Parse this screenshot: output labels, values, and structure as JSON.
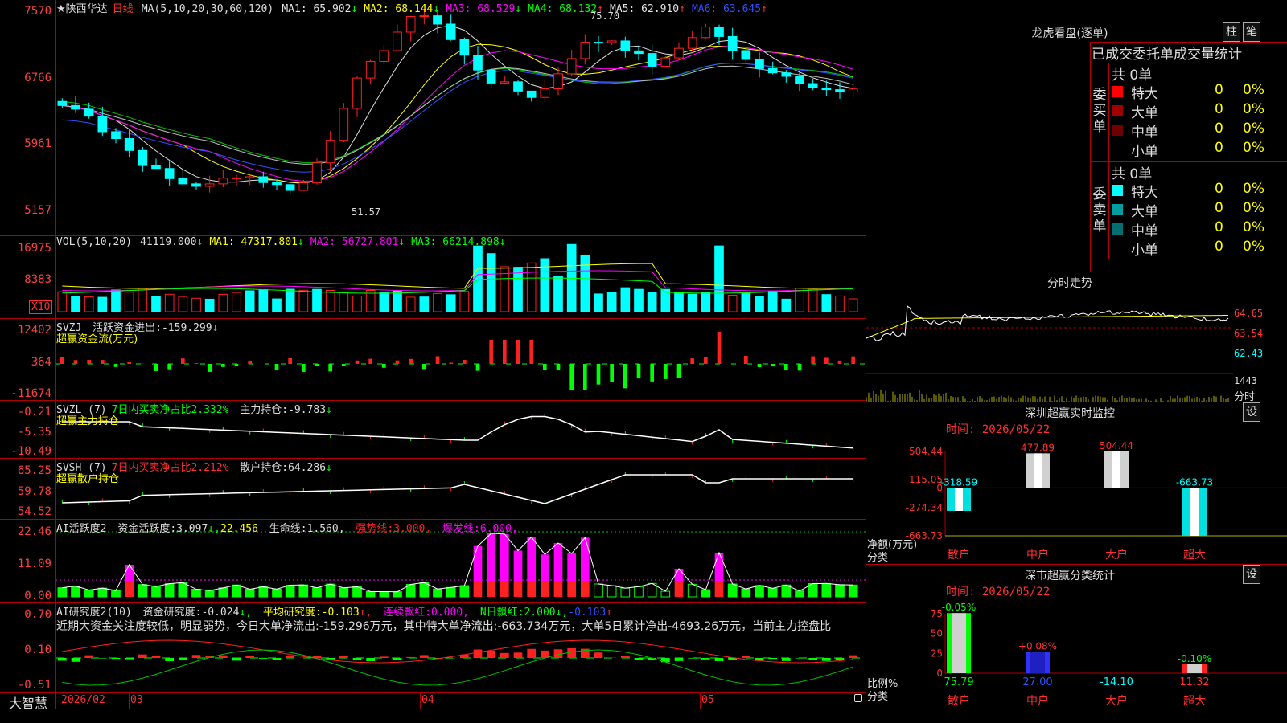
{
  "main_legend": {
    "star": "★",
    "stock_name": "陕西华达",
    "period": "日线",
    "ma_params": "MA(5,10,20,30,60,120)",
    "items": [
      {
        "label": "MA1:",
        "value": "65.902",
        "arrow": "↓",
        "color": "#e0e0e0"
      },
      {
        "label": "MA2:",
        "value": "68.144",
        "arrow": "↓",
        "color": "#ffff00"
      },
      {
        "label": "MA3:",
        "value": "68.529",
        "arrow": "↓",
        "color": "#ff00ff"
      },
      {
        "label": "MA4:",
        "value": "68.132",
        "arrow": "↑",
        "color": "#00ff00"
      },
      {
        "label": "MA5:",
        "value": "62.910",
        "arrow": "↑",
        "color": "#e0e0e0"
      },
      {
        "label": "MA6:",
        "value": "63.645",
        "arrow": "↑",
        "color": "#3050ff"
      }
    ],
    "high_mark": "75.70",
    "low_mark": "51.57"
  },
  "main_axis": [
    "7570",
    "6766",
    "5961",
    "5157"
  ],
  "vol_legend": {
    "title": "VOL(5,10,20)",
    "items": [
      {
        "label": "",
        "value": "41119.000",
        "arrow": "↓",
        "color": "#e0e0e0"
      },
      {
        "label": "MA1:",
        "value": "47317.801",
        "arrow": "↓",
        "color": "#ffff00"
      },
      {
        "label": "MA2:",
        "value": "56727.801",
        "arrow": "↓",
        "color": "#ff00ff"
      },
      {
        "label": "MA3:",
        "value": "66214.898",
        "arrow": "↓",
        "color": "#00ff00"
      }
    ]
  },
  "vol_axis": [
    "16975",
    "8383"
  ],
  "vol_unit": "X10",
  "svzj": {
    "title": "SVZJ",
    "label": "活跃资金进出:",
    "value": "-159.299",
    "arrow": "↓",
    "sub": "超赢资金流(万元)",
    "axis": [
      "12402",
      "364",
      "-11674"
    ]
  },
  "svzl": {
    "title": "SVZL (7)",
    "label": "7日内买卖净占比2.332%",
    "label2": "主力持仓:",
    "value": "-9.783",
    "arrow": "↓",
    "sub": "超赢主力持仓",
    "axis": [
      "-0.21",
      "-5.35",
      "-10.49"
    ]
  },
  "svsh": {
    "title": "SVSH (7)",
    "label": "7日内买卖净占比2.212%",
    "label2": "散户持仓:",
    "value": "64.286",
    "arrow": "↓",
    "sub": "超赢散户持仓",
    "axis": [
      "65.25",
      "59.78",
      "54.52"
    ]
  },
  "ai_active": {
    "title": "AI活跃度2",
    "l1": "资金活跃度:",
    "v1": "3.097",
    "a1": "↓",
    "v2": "22.456",
    "a2": ",",
    "l3": "生命线:",
    "v3": "1.560,",
    "l4": "强势线:",
    "v4": "3.000,",
    "l5": "爆发线:",
    "v5": "6.000,",
    "axis": [
      "22.46",
      "11.09",
      "0.00"
    ]
  },
  "ai_research": {
    "title": "AI研究度2(10)",
    "l1": "资金研究度:",
    "v1": "-0.024",
    "a1": "↓,",
    "l2": "平均研究度:",
    "v2": "-0.103",
    "a2": "↑,",
    "l3": "连续飘红:",
    "v3": "0.000,",
    "l4": "N日飘红:",
    "v4": "2.000",
    "a4": "↓,",
    "v5": "-0.103",
    "a5": "↑",
    "comment": "近期大资金关注度较低，明显弱势，今日大单净流出:-159.296万元，其中特大单净流出:-663.734万元，大单5日累计净出-4693.26万元，当前主力控盘比",
    "axis": [
      "0.70",
      "0.10",
      "-0.51"
    ]
  },
  "bottom_bar": {
    "brand": "大智慧",
    "dates": [
      "2026/02",
      "03",
      "04",
      "05"
    ]
  },
  "dragon": {
    "title": "龙虎看盘(逐单)",
    "btn1": "柱",
    "btn2": "笔",
    "headers": [
      "已成交",
      "委托单",
      "成交量统计"
    ],
    "buy_label": "委买单",
    "sell_label": "委卖单",
    "buy_total": "共 0单",
    "sell_total": "共 0单",
    "buy_rows": [
      {
        "name": "特大",
        "count": "0",
        "pct": "0%",
        "color": "#ff0000"
      },
      {
        "name": "大单",
        "count": "0",
        "pct": "0%",
        "color": "#a00000"
      },
      {
        "name": "中单",
        "count": "0",
        "pct": "0%",
        "color": "#700000"
      },
      {
        "name": "小单",
        "count": "0",
        "pct": "0%",
        "color": ""
      }
    ],
    "sell_rows": [
      {
        "name": "特大",
        "count": "0",
        "pct": "0%",
        "color": "#00ffff"
      },
      {
        "name": "大单",
        "count": "0",
        "pct": "0%",
        "color": "#00a0a0"
      },
      {
        "name": "中单",
        "count": "0",
        "pct": "0%",
        "color": "#007070"
      },
      {
        "name": "小单",
        "count": "0",
        "pct": "0%",
        "color": ""
      }
    ]
  },
  "intraday": {
    "title": "分时走势",
    "axis": [
      "64.65",
      "63.54",
      "62.43"
    ],
    "vol_axis": "1443",
    "vol_unit": "分时"
  },
  "sz_monitor": {
    "title": "深圳超赢实时监控",
    "btn": "设",
    "time": "时间: 2026/05/22",
    "axis": [
      "504.44",
      "115.05",
      "0",
      "-274.34",
      "-663.73"
    ],
    "ylabel": "净额(万元)",
    "xlabel": "分类",
    "chart_data": {
      "type": "bar",
      "categories": [
        "散户",
        "中户",
        "大户",
        "超大"
      ],
      "values": [
        -318.59,
        477.89,
        504.44,
        -663.73
      ],
      "ylim": [
        -663.73,
        504.44
      ]
    }
  },
  "sz_class": {
    "title": "深市超赢分类统计",
    "btn": "设",
    "time": "时间: 2026/05/22",
    "axis": [
      "75",
      "50",
      "25",
      "0"
    ],
    "ylabel": "比例%",
    "xlabel": "分类",
    "chart_data": {
      "type": "bar",
      "categories": [
        "散户",
        "中户",
        "大户",
        "超大"
      ],
      "values": [
        75.79,
        27.0,
        -14.1,
        11.32
      ],
      "changes": [
        "-0.05%",
        "+0.08%",
        "",
        "-0.10%"
      ],
      "ylim": [
        0,
        75
      ]
    }
  }
}
